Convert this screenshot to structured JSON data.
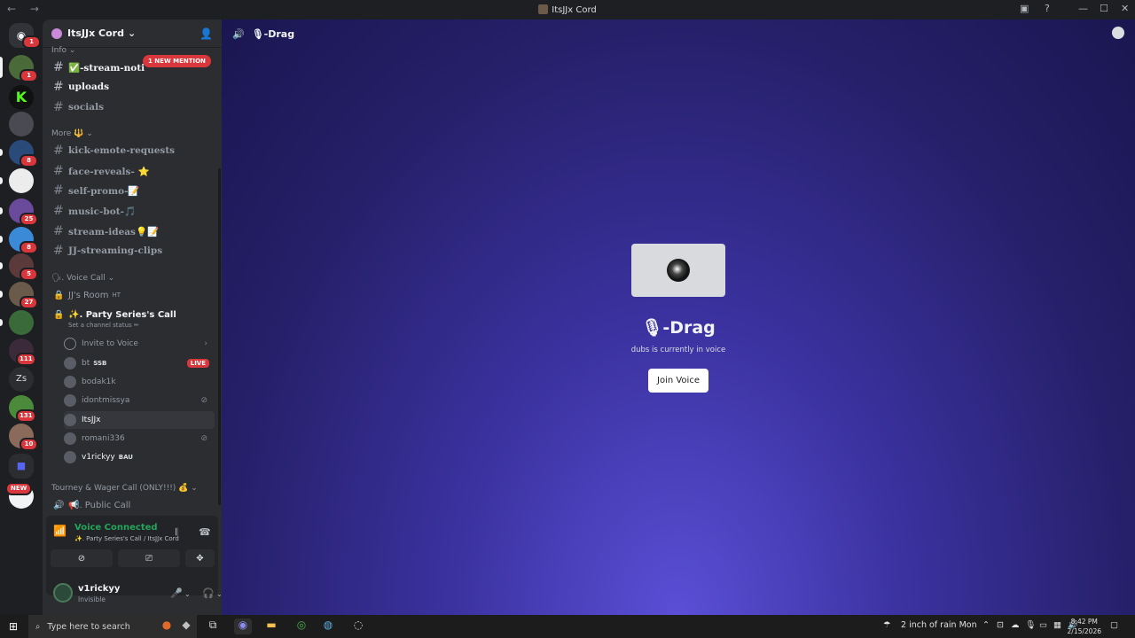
{
  "window": {
    "title": "ItsJJx Cord",
    "nav": "← →",
    "controls": [
      "—",
      "☐",
      "✕"
    ]
  },
  "guilds": {
    "dm_badge": "1",
    "items": [
      {
        "badge": "1",
        "color": "#4a6a3a"
      },
      {
        "badge": "",
        "color": "#111111",
        "letter": "K"
      },
      {
        "badge": "",
        "color": "#4a4a52"
      },
      {
        "badge": "8",
        "color": "#2a4a7a"
      },
      {
        "badge": "",
        "color": "#ececec"
      },
      {
        "badge": "25",
        "color": "#6a4a9a"
      },
      {
        "badge": "8",
        "color": "#3a8ad8"
      },
      {
        "badge": "5",
        "color": "#5a3a3a"
      },
      {
        "badge": "27",
        "color": "#6a5a4a"
      },
      {
        "badge": "",
        "color": "#3a6a3a"
      },
      {
        "badge": "111",
        "color": "#3a2a3a"
      },
      {
        "badge": "",
        "color": "#2b2d31",
        "letter": "Zs"
      },
      {
        "badge": "131",
        "color": "#4a8a3a"
      },
      {
        "badge": "10",
        "color": "#8a6a5a"
      },
      {
        "badge": "",
        "color": "#2b2d31"
      },
      {
        "badge": "NEW",
        "color": "#f2f3f5"
      }
    ]
  },
  "server": {
    "name": "ItsJJx Cord",
    "caret": "⌄"
  },
  "categories": {
    "info": "Info ⌄",
    "more": "More 🔱 ⌄",
    "voice": "🗣. Voice Call ⌄",
    "tourney": "Tourney & Wager Call (ONLY!!!) 💰 ⌄"
  },
  "mention_pill": "1 NEW MENTION",
  "text_channels": [
    {
      "name": "✅-stream-noti",
      "unread": true
    },
    {
      "name": "uploads",
      "unread": true
    },
    {
      "name": "socials",
      "unread": false
    },
    {
      "name": "kick-emote-requests",
      "unread": false
    },
    {
      "name": "face-reveals- ⭐",
      "unread": false
    },
    {
      "name": "self-promo-📝",
      "unread": false
    },
    {
      "name": "music-bot-🎵",
      "unread": false
    },
    {
      "name": "stream-ideas💡📝",
      "unread": false
    },
    {
      "name": "JJ-streaming-clips",
      "unread": false
    }
  ],
  "voice_channels": {
    "jj_room": "JJ's Room",
    "jj_room_tag": "HT",
    "party": "✨. Party Series's Call",
    "party_status": "Set a channel status ✏",
    "public": "📢. Public Call"
  },
  "members": [
    {
      "name": "Invite to Voice",
      "tag": "",
      "live": false,
      "muted": false
    },
    {
      "name": "bt",
      "tag": "SSB",
      "live": true,
      "muted": false
    },
    {
      "name": "bodak1k",
      "tag": "",
      "live": false,
      "muted": false
    },
    {
      "name": "idontmissya",
      "tag": "",
      "live": false,
      "muted": true
    },
    {
      "name": "ItsJJx",
      "tag": "",
      "live": false,
      "muted": false
    },
    {
      "name": "romani336",
      "tag": "",
      "live": false,
      "muted": true
    },
    {
      "name": "v1rickyy",
      "tag": "BAU",
      "live": false,
      "muted": false
    }
  ],
  "live_label": "LIVE",
  "voice_panel": {
    "title": "Voice Connected",
    "subtitle": "✨. Party Series's Call / ItsJJx Cord"
  },
  "user": {
    "name": "v1rickyy",
    "status": "Invisible"
  },
  "main": {
    "header": "🎙-Drag",
    "channel_name": "🎙-Drag",
    "subtitle": "dubs is currently in voice",
    "join_label": "Join Voice"
  },
  "taskbar": {
    "search_placeholder": "Type here to search",
    "weather": "2 inch of rain Mon",
    "time": "8:42 PM",
    "date": "2/15/2026"
  }
}
